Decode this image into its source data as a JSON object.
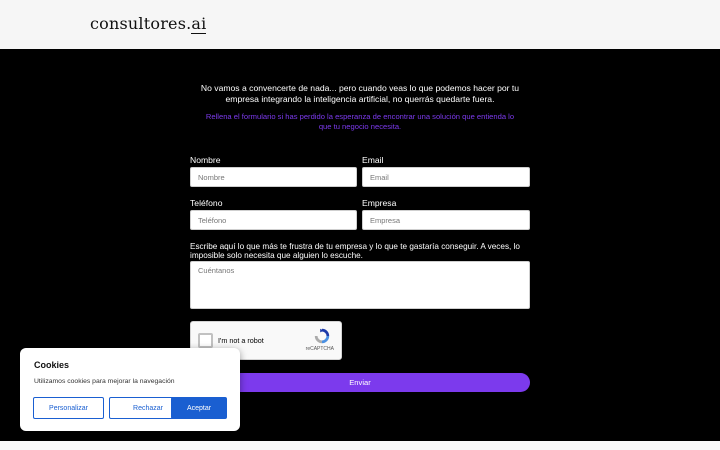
{
  "header": {
    "logo_main": "consultores.",
    "logo_accent": "ai"
  },
  "intro": {
    "text": "No vamos a convencerte de nada... pero cuando veas lo que podemos hacer por tu empresa integrando la inteligencia artificial, no querrás quedarte fuera.",
    "subtext": "Rellena el formulario si has perdido la esperanza de encontrar una solución que entienda lo que tu negocio necesita."
  },
  "form": {
    "nombre": {
      "label": "Nombre",
      "placeholder": "Nombre"
    },
    "email": {
      "label": "Email",
      "placeholder": "Email"
    },
    "telefono": {
      "label": "Teléfono",
      "placeholder": "Teléfono"
    },
    "empresa": {
      "label": "Empresa",
      "placeholder": "Empresa"
    },
    "mensaje": {
      "label": "Escribe aquí lo que más te frustra de tu empresa y lo que te gastaría conseguir. A veces, lo imposible solo necesita que alguien lo escuche.",
      "placeholder": "Cuéntanos"
    },
    "captcha": {
      "label": "I'm not a robot",
      "brand": "reCAPTCHA"
    },
    "submit_label": "Enviar"
  },
  "cookies": {
    "title": "Cookies",
    "text": "Utilizamos cookies para mejorar la navegación",
    "personalizar": "Personalizar",
    "rechazar": "Rechazar",
    "aceptar": "Aceptar"
  },
  "colors": {
    "accent_purple": "#7c3aed",
    "cookie_blue": "#1a5fd1"
  }
}
